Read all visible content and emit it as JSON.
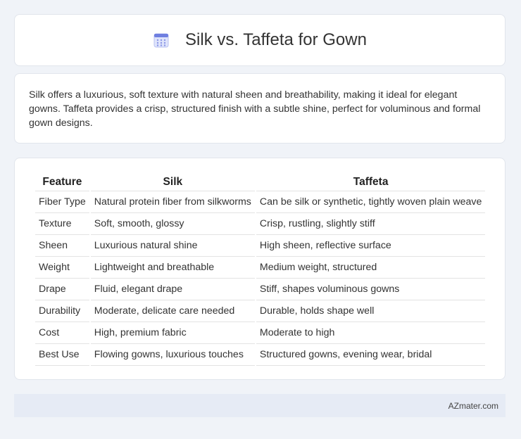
{
  "header": {
    "title": "Silk vs. Taffeta for Gown",
    "icon": "calendar-icon"
  },
  "intro": {
    "text": "Silk offers a luxurious, soft texture with natural sheen and breathability, making it ideal for elegant gowns. Taffeta provides a crisp, structured finish with a subtle shine, perfect for voluminous and formal gown designs."
  },
  "table": {
    "headers": [
      "Feature",
      "Silk",
      "Taffeta"
    ],
    "rows": [
      [
        "Fiber Type",
        "Natural protein fiber from silkworms",
        "Can be silk or synthetic, tightly woven plain weave"
      ],
      [
        "Texture",
        "Soft, smooth, glossy",
        "Crisp, rustling, slightly stiff"
      ],
      [
        "Sheen",
        "Luxurious natural shine",
        "High sheen, reflective surface"
      ],
      [
        "Weight",
        "Lightweight and breathable",
        "Medium weight, structured"
      ],
      [
        "Drape",
        "Fluid, elegant drape",
        "Stiff, shapes voluminous gowns"
      ],
      [
        "Durability",
        "Moderate, delicate care needed",
        "Durable, holds shape well"
      ],
      [
        "Cost",
        "High, premium fabric",
        "Moderate to high"
      ],
      [
        "Best Use",
        "Flowing gowns, luxurious touches",
        "Structured gowns, evening wear, bridal"
      ]
    ]
  },
  "footer": {
    "brand": "AZmater.com"
  },
  "colors": {
    "background": "#f0f3f8",
    "footer": "#e6ebf5",
    "icon_accent": "#6f7fe0"
  }
}
